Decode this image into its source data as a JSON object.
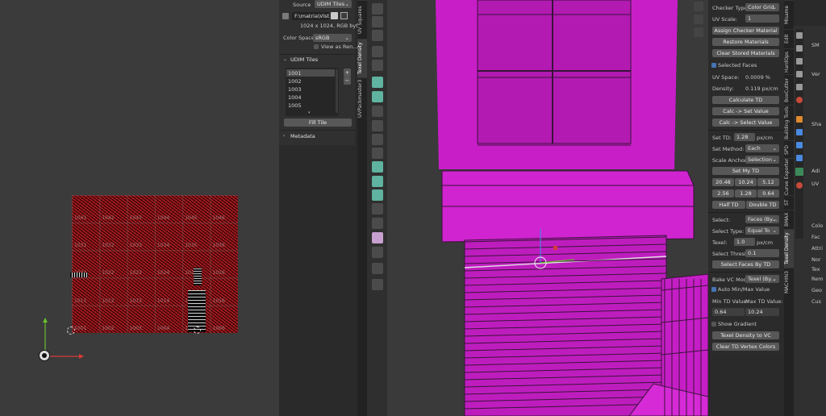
{
  "uv_editor": {
    "tile_rows": [
      [
        "1041",
        "1042",
        "1043",
        "1044",
        "1045",
        "1046"
      ],
      [
        "1031",
        "1032",
        "1033",
        "1034",
        "1035",
        "1036"
      ],
      [
        "1021",
        "1022",
        "1023",
        "1024",
        "1025",
        "1026"
      ],
      [
        "1011",
        "1012",
        "1013",
        "1014",
        "1015",
        "1016"
      ],
      [
        "1001",
        "1002",
        "1003",
        "1004",
        "1005",
        "1006"
      ]
    ]
  },
  "image_panel": {
    "source_label": "Source",
    "source_value": "UDIM Tiles",
    "filepath": "F:\\matria\\Vistud...",
    "info": "1024 x 1024,  RGB byte",
    "color_space_label": "Color Space",
    "color_space_value": "sRGB",
    "view_as_render": "View as Ren...",
    "udim_header": "UDIM Tiles",
    "udim_tiles": [
      "1001",
      "1002",
      "1003",
      "1004",
      "1005"
    ],
    "fill_tile": "Fill Tile",
    "metadata_header": "Metadata"
  },
  "uv_vtabs": [
    "UV Squares",
    "Texel Density",
    "UVPackmaster3"
  ],
  "td_panel": {
    "checker_type_label": "Checker Type:",
    "checker_type_value": "Color Grid",
    "uv_scale_label": "UV Scale:",
    "uv_scale_value": "1",
    "assign_checker": "Assign Checker Material",
    "restore_materials": "Restore Materials",
    "clear_stored": "Clear Stored Materials",
    "selected_faces": "Selected Faces",
    "uv_space_label": "UV Space:",
    "uv_space_value": "0.0009 %",
    "density_label": "Density:",
    "density_value": "0.119 px/cm",
    "calculate_td": "Calculate TD",
    "calc_set_value": "Calc -> Set Value",
    "calc_select_value": "Calc -> Select Value",
    "set_td_label": "Set TD:",
    "set_td_value": "1.28",
    "set_td_unit": "px/cm",
    "set_method_label": "Set Method:",
    "set_method_value": "Each",
    "scale_anchor_label": "Scale Anchor:",
    "scale_anchor_value": "Selection",
    "set_my_td": "Set My TD",
    "presets_row1": [
      "20.48",
      "10.24",
      "5.12"
    ],
    "presets_row2": [
      "2.56",
      "1.28",
      "0.64"
    ],
    "half_td": "Half TD",
    "double_td": "Double TD",
    "select_label": "Select:",
    "select_value": "Faces (By...",
    "select_type_label": "Select Type:",
    "select_type_value": "Equal To",
    "texel_label": "Texel:",
    "texel_value": "1.0",
    "texel_unit": "px/cm",
    "select_thresh_label": "Select Thresh:",
    "select_thresh_value": "0.1",
    "select_faces_by_td": "Select Faces By TD",
    "bake_vc_label": "Bake VC Mod...",
    "bake_vc_value": "Texel (By...",
    "auto_minmax": "Auto Min/Max Value",
    "min_td_label": "Min TD Value:",
    "max_td_label": "Max TD Value:",
    "min_td_value": "0.64",
    "max_td_value": "10.24",
    "show_gradient": "Show Gradient",
    "td_to_vc": "Texel Density to VC",
    "clear_td_vc": "Clear TD Vertex Colors"
  },
  "td_vtabs": [
    "Misame",
    "Edit",
    "HardOps",
    "BoxCutter",
    "Building Tools",
    "SPD",
    "Curve Exporter",
    "ST",
    "BMAX",
    "Texel Density",
    "MACHIN3"
  ],
  "props": {
    "items": [
      "SM",
      "Ver",
      "Sha",
      "Adi",
      "UV",
      "Colo",
      "Fac",
      "Attri",
      "Nor",
      "Tex",
      "Rem",
      "Geo",
      "Cus"
    ]
  },
  "colors": {
    "accent_blue": "#4772b3",
    "mesh_magenta": "#c81ec8",
    "uv_red": "#8e1a1e"
  }
}
